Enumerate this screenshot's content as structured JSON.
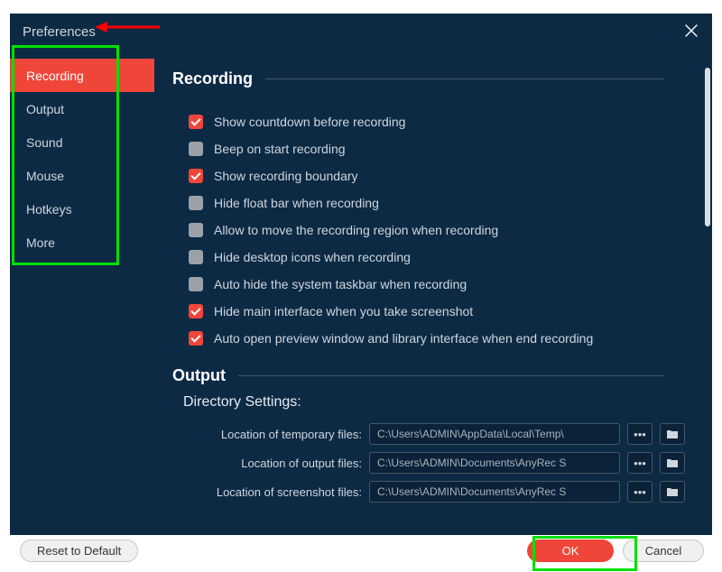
{
  "window": {
    "title": "Preferences"
  },
  "colors": {
    "accent": "#f0463a",
    "bg": "#0d2a45",
    "highlight": "#00E000"
  },
  "sidebar": {
    "items": [
      {
        "label": "Recording",
        "active": true
      },
      {
        "label": "Output",
        "active": false
      },
      {
        "label": "Sound",
        "active": false
      },
      {
        "label": "Mouse",
        "active": false
      },
      {
        "label": "Hotkeys",
        "active": false
      },
      {
        "label": "More",
        "active": false
      }
    ]
  },
  "sections": {
    "recording": {
      "title": "Recording",
      "options": [
        {
          "label": "Show countdown before recording",
          "checked": true
        },
        {
          "label": "Beep on start recording",
          "checked": false
        },
        {
          "label": "Show recording boundary",
          "checked": true
        },
        {
          "label": "Hide float bar when recording",
          "checked": false
        },
        {
          "label": "Allow to move the recording region when recording",
          "checked": false
        },
        {
          "label": "Hide desktop icons when recording",
          "checked": false
        },
        {
          "label": "Auto hide the system taskbar when recording",
          "checked": false
        },
        {
          "label": "Hide main interface when you take screenshot",
          "checked": true
        },
        {
          "label": "Auto open preview window and library interface when end recording",
          "checked": true
        }
      ]
    },
    "output": {
      "title": "Output",
      "directory_heading": "Directory Settings:",
      "rows": [
        {
          "label": "Location of temporary files:",
          "value": "C:\\Users\\ADMIN\\AppData\\Local\\Temp\\"
        },
        {
          "label": "Location of output files:",
          "value": "C:\\Users\\ADMIN\\Documents\\AnyRec S"
        },
        {
          "label": "Location of screenshot files:",
          "value": "C:\\Users\\ADMIN\\Documents\\AnyRec S"
        }
      ],
      "browse_icon_label": "•••",
      "folder_icon_name": "folder-icon"
    }
  },
  "footer": {
    "reset": "Reset to Default",
    "ok": "OK",
    "cancel": "Cancel"
  }
}
